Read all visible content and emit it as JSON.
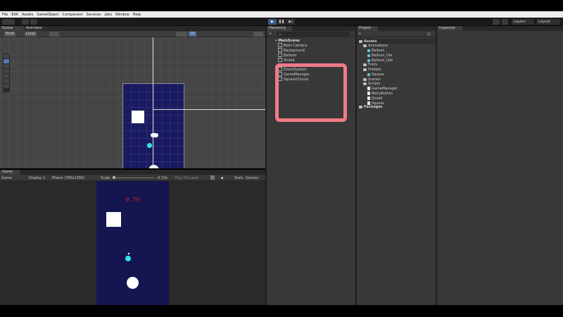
{
  "menu": [
    "File",
    "Edit",
    "Assets",
    "GameObject",
    "Component",
    "Services",
    "Jobs",
    "Window",
    "Help"
  ],
  "toolbar": {
    "layers": "Layers",
    "layout": "Layout",
    "play": "▶",
    "pause": "❚❚",
    "step": "▶|"
  },
  "scene_panel": {
    "tabs": [
      "Scene",
      "Animator"
    ],
    "pivot": "Pivot",
    "local": "Local",
    "mode_2d": "2D"
  },
  "game_panel": {
    "tab": "Game",
    "display_mode": "Game",
    "display": "Display 1",
    "resolution": "Phone (760x1280)",
    "scale_label": "Scale",
    "scale_value": "0.33x",
    "play_focused": "Play Focused",
    "stats": "Stats",
    "gizmos": "Gizmos",
    "score": "0.75"
  },
  "hierarchy": {
    "tab": "Hierarchy",
    "search_placeholder": "All",
    "scene": "MainScene",
    "items": [
      "Main Camera",
      "Background",
      "Balloon",
      "Shield",
      "EventSystem",
      "GameManager",
      "Square(Clone)"
    ]
  },
  "project": {
    "tab": "Project",
    "count": "21",
    "assets": "Assets",
    "tree": [
      {
        "label": "Animations",
        "kind": "folder"
      },
      {
        "label": "Balloon",
        "kind": "asset"
      },
      {
        "label": "Balloon_Die",
        "kind": "asset"
      },
      {
        "label": "Balloon_Idle",
        "kind": "asset"
      },
      {
        "label": "Fonts",
        "kind": "folder"
      },
      {
        "label": "Prefabs",
        "kind": "folder"
      },
      {
        "label": "Square",
        "kind": "asset"
      },
      {
        "label": "Scenes",
        "kind": "folder"
      },
      {
        "label": "Scripts",
        "kind": "folder"
      },
      {
        "label": "GameManager",
        "kind": "script"
      },
      {
        "label": "RetryButton",
        "kind": "script"
      },
      {
        "label": "Shield",
        "kind": "script"
      },
      {
        "label": "Square",
        "kind": "script"
      }
    ],
    "packages": "Packages"
  },
  "inspector": {
    "tab": "Inspector"
  },
  "colors": {
    "annotation": "#f07a86",
    "game_bg": "#15154f",
    "score": "#e02020",
    "shield": "#2ee6f0"
  }
}
